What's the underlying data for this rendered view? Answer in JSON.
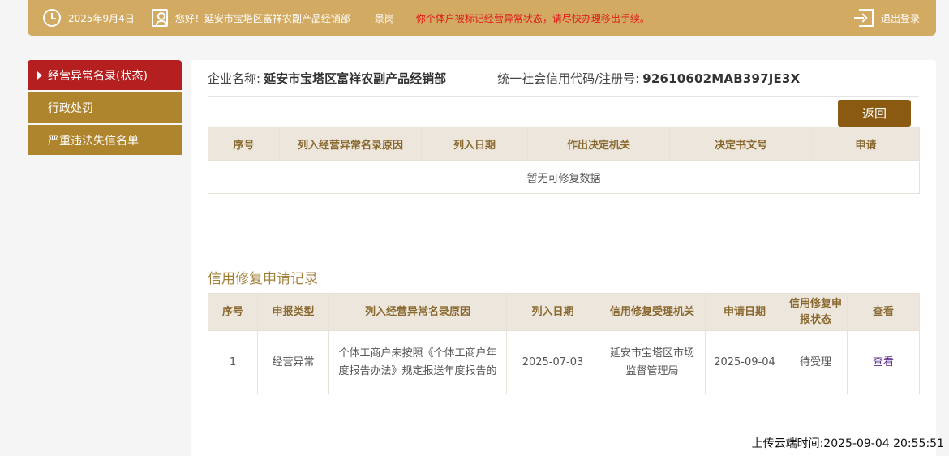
{
  "topbar": {
    "date": "2025年9月4日",
    "greeting": "您好！延安市宝塔区富祥农副产品经销部",
    "role": "景岗",
    "warning": "你个体户被标记经营异常状态，请尽快办理移出手续。",
    "logout": "退出登录"
  },
  "sidebar": {
    "items": [
      {
        "label": "经营异常名录(状态)",
        "active": true
      },
      {
        "label": "行政处罚",
        "active": false
      },
      {
        "label": "严重违法失信名单",
        "active": false
      }
    ]
  },
  "company": {
    "name_label": "企业名称:",
    "name": "延安市宝塔区富祥农副产品经销部",
    "code_label": "统一社会信用代码/注册号:",
    "code": "92610602MAB397JE3X"
  },
  "back_button": "返回",
  "abnormal_table": {
    "headers": [
      "序号",
      "列入经营异常名录原因",
      "列入日期",
      "作出决定机关",
      "决定书文号",
      "申请"
    ],
    "empty_text": "暂无可修复数据"
  },
  "records": {
    "title": "信用修复申请记录",
    "headers": [
      "序号",
      "申报类型",
      "列入经营异常名录原因",
      "列入日期",
      "信用修复受理机关",
      "申请日期",
      "信用修复申报状态",
      "查看"
    ],
    "rows": [
      [
        "1",
        "经营异常",
        "个体工商户未按照《个体工商户年度报告办法》规定报送年度报告的",
        "2025-07-03",
        "延安市宝塔区市场监督管理局",
        "2025-09-04",
        "待受理",
        "查看"
      ]
    ]
  },
  "upload_time": "上传云端时间:2025-09-04 20:55:51"
}
